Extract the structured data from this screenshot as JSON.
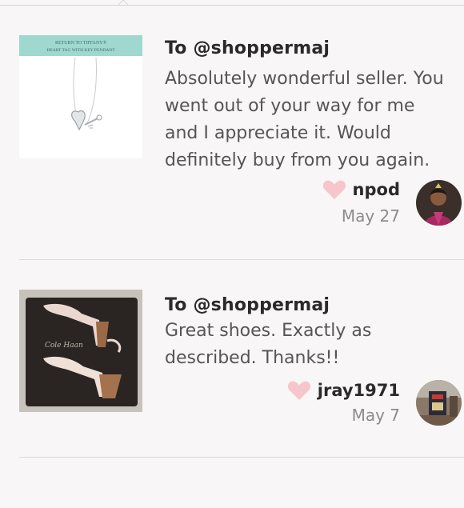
{
  "reviews": [
    {
      "to_line": "To @shoppermaj",
      "lines": [
        "Absolutely wonderful seller. You",
        "went out of your way for me",
        "and I appreciate it. Would",
        "definitely buy from you again."
      ],
      "username": "npod",
      "date": "May 27",
      "thumb_caption": [
        "RETURN TO TIFFANY®",
        "HEART TAG WITH KEY PENDANT"
      ],
      "thumb_icon": "tiffany-necklace-thumbnail",
      "heart_color": "#f7c5cc"
    },
    {
      "to_line": "To @shoppermaj",
      "lines": [
        "Great shoes. Exactly as",
        "described. Thanks!!"
      ],
      "username": "jray1971",
      "date": "May 7",
      "thumb_icon": "wedge-shoes-thumbnail",
      "heart_color": "#f7c5cc"
    }
  ]
}
